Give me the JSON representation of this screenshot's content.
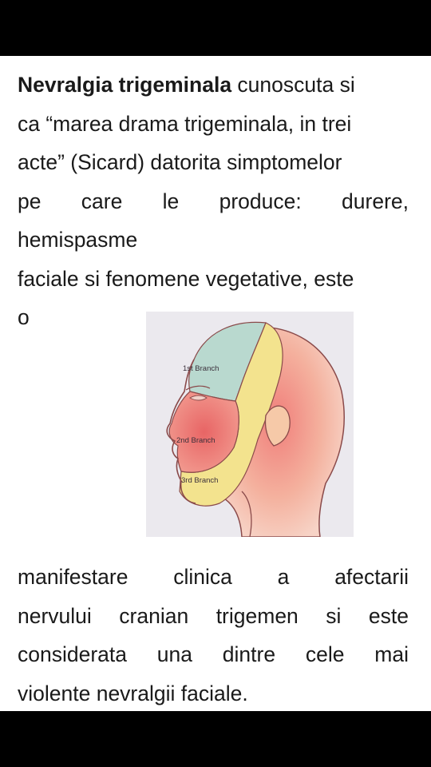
{
  "article": {
    "paragraph1": {
      "lead_bold": "Nevralgia trigeminala",
      "line1_rest": " cunoscuta si",
      "line2": "ca “marea drama trigeminala, in trei",
      "line3": "acte” (Sicard) datorita simptomelor",
      "line4": "pe care le produce: durere,",
      "line5": "hemispasme",
      "line6": "faciale si fenomene vegetative, este",
      "line7": "o"
    },
    "figure": {
      "branch1_label": "1st Branch",
      "branch2_label": "2nd Branch",
      "branch3_label": "3rd Branch",
      "colors": {
        "branch1": "#b9d9cf",
        "branch2": "#ee8c88",
        "branch3": "#f3e38e",
        "background": "#ebe9ee"
      }
    },
    "paragraph2": {
      "line1": "manifestare clinica a afectarii",
      "line2": "nervului cranian trigemen si este",
      "line3": "considerata una dintre cele mai",
      "line4": "violente nevralgii faciale."
    }
  }
}
